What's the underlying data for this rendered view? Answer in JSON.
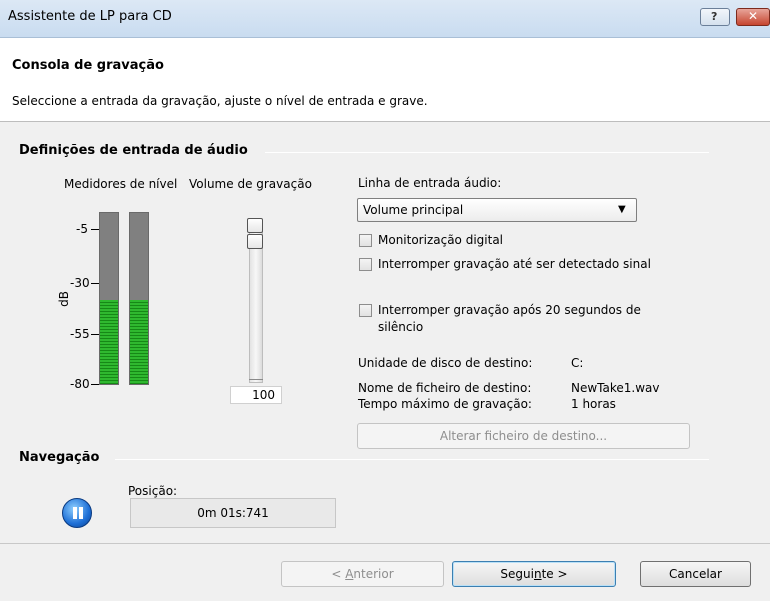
{
  "window": {
    "title": "Assistente de LP para CD",
    "help_glyph": "?",
    "close_glyph": "✕"
  },
  "header": {
    "title": "Consola de gravação",
    "subtitle": "Seleccione a entrada da gravação, ajuste o nível de entrada e grave."
  },
  "audio_section": {
    "title": "Definições de entrada de áudio",
    "level_meters_label": "Medidores de nível",
    "recording_volume_label": "Volume de gravação",
    "db_axis_label": "dB",
    "db_ticks": [
      "-5",
      "-30",
      "-55",
      "-80"
    ],
    "meters": [
      {
        "name": "left",
        "level_fraction": 0.49
      },
      {
        "name": "right",
        "level_fraction": 0.49
      }
    ],
    "volume_value": "100",
    "input_line_label": "Linha de entrada áudio:",
    "input_line_selected": "Volume principal",
    "checkboxes": [
      {
        "label": "Monitorização digital",
        "checked": false
      },
      {
        "label": "Interromper gravação até ser detectado sinal",
        "checked": false
      },
      {
        "label_line1": "Interromper gravação após 20 segundos de",
        "label_line2": "silêncio",
        "checked": false
      }
    ],
    "dest_drive_label": "Unidade de disco de destino:",
    "dest_drive_value": "C:",
    "dest_file_label": "Nome de ficheiro de destino:",
    "dest_file_value": "NewTake1.wav",
    "max_time_label": "Tempo máximo de gravação:",
    "max_time_value": "1 horas",
    "change_dest_button": "Alterar ficheiro de destino..."
  },
  "navigation": {
    "title": "Navegação",
    "position_label": "Posição:",
    "position_value": "0m 01s:741"
  },
  "footer": {
    "back_prefix": "< ",
    "back_mnemonic": "A",
    "back_rest": "nterior",
    "next_pre": "Segui",
    "next_mnemonic": "n",
    "next_post": "te >",
    "cancel_label": "Cancelar"
  }
}
